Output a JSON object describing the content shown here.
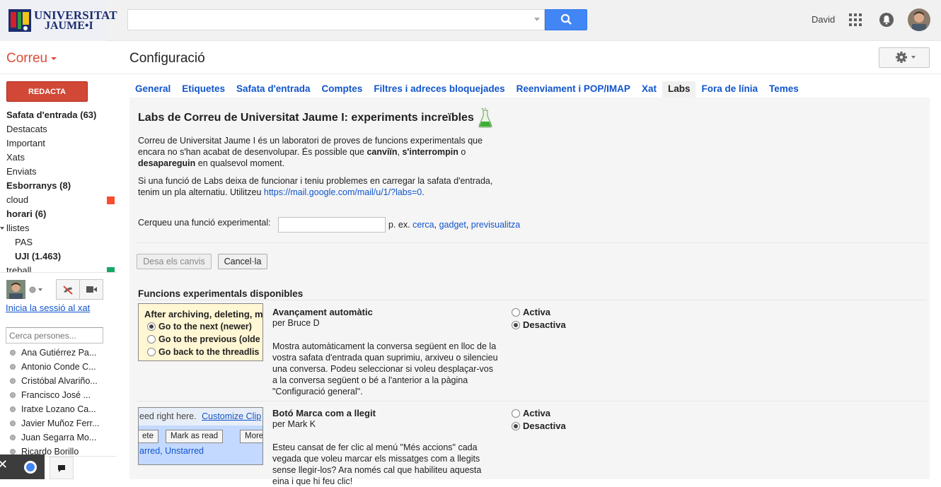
{
  "header": {
    "logo_line1": "UNIVERSITAT",
    "logo_line2": "JAUME•I",
    "search_value": "",
    "user_name": "David",
    "colors": {
      "brand_red": "#dd4b39",
      "search_blue": "#4285f4",
      "link_blue": "#1155cc"
    }
  },
  "nav": {
    "app_label": "Correu",
    "page_title": "Configuració",
    "compose_label": "REDACTA",
    "labels": [
      {
        "text": "Safata d'entrada (63)",
        "bold": true
      },
      {
        "text": "Destacats",
        "bold": false
      },
      {
        "text": "Important",
        "bold": false
      },
      {
        "text": "Xats",
        "bold": false
      },
      {
        "text": "Enviats",
        "bold": false
      },
      {
        "text": "Esborranys (8)",
        "bold": true
      },
      {
        "text": "cloud",
        "bold": false,
        "color": "#fb4c2f"
      },
      {
        "text": "horari (6)",
        "bold": true
      },
      {
        "text": "llistes",
        "bold": false,
        "expandable": true
      },
      {
        "text": "PAS",
        "bold": false,
        "sub": true
      },
      {
        "text": "UJI (1.463)",
        "bold": true,
        "sub": true
      },
      {
        "text": "treball",
        "bold": false,
        "color": "#16a766"
      }
    ]
  },
  "chat": {
    "login_text": "Inicia la sessió al xat",
    "search_placeholder": "Cerca persones...",
    "people": [
      "Ana Gutiérrez Pa...",
      "Antonio Conde C...",
      "Cristóbal Alvariño...",
      "Francisco José ...",
      "Iratxe Lozano Ca...",
      "Javier Muñoz Ferr...",
      "Juan Segarra Mo...",
      "Ricardo Borillo"
    ]
  },
  "tabs": [
    {
      "label": "General",
      "active": false
    },
    {
      "label": "Etiquetes",
      "active": false
    },
    {
      "label": "Safata d'entrada",
      "active": false
    },
    {
      "label": "Comptes",
      "active": false
    },
    {
      "label": "Filtres i adreces bloquejades",
      "active": false
    },
    {
      "label": "Reenviament i POP/IMAP",
      "active": false
    },
    {
      "label": "Xat",
      "active": false
    },
    {
      "label": "Labs",
      "active": true
    },
    {
      "label": "Fora de línia",
      "active": false
    },
    {
      "label": "Temes",
      "active": false
    }
  ],
  "labs": {
    "title": "Labs de Correu de Universitat Jaume I: experiments increïbles",
    "intro_a": "Correu de Universitat Jaume I és un laboratori de proves de funcions experimentals que encara no s'han acabat de desenvolupar. És possible que ",
    "intro_b1": "canviïn",
    "intro_c": ", ",
    "intro_b2": "s'interrompin",
    "intro_d": " o ",
    "intro_b3": "desapareguin",
    "intro_e": " en qualsevol moment.",
    "fallback_a": "Si una funció de Labs deixa de funcionar i teniu problemes en carregar la safata d'entrada, tenim un pla alternatiu. Utilitzeu ",
    "fallback_link": "https://mail.google.com/mail/u/1/?labs=0",
    "fallback_b": ".",
    "search_label": "Cerqueu una funció experimental:",
    "search_value": "",
    "hint_prefix": "p. ex.",
    "hint_links": [
      "cerca",
      "gadget",
      "previsualitza"
    ],
    "save_label": "Desa els canvis",
    "cancel_label": "Cancel·la",
    "available_heading": "Funcions experimentals disponibles",
    "enable_label": "Activa",
    "disable_label": "Desactiva",
    "experiments": [
      {
        "name": "Avançament automàtic",
        "author": "per Bruce D",
        "description": "Mostra automàticament la conversa següent en lloc de la vostra safata d'entrada quan suprimiu, arxiveu o silencieu una conversa. Podeu seleccionar si voleu desplaçar-vos a la conversa següent o bé a l'anterior a la pàgina \"Configuració general\".",
        "enabled": false,
        "thumb": {
          "heading": "After archiving, deleting, m",
          "options": [
            "Go to the next (newer)",
            "Go to the previous (olde",
            "Go back to the threadlis"
          ]
        }
      },
      {
        "name": "Botó Marca com a llegit",
        "author": "per Mark K",
        "description": "Esteu cansat de fer clic al menú \"Més accions\" cada vegada que voleu marcar els missatges com a llegits sense llegir-los? Ara només cal que habiliteu aquesta eina i que hi feu clic!",
        "enabled": false,
        "thumb": {
          "strip_text": "eed right here.",
          "strip_link": "Customize Clip",
          "buttons": [
            "ete",
            "Mark as read",
            "More"
          ],
          "links": "arred, Unstarred"
        }
      }
    ]
  }
}
